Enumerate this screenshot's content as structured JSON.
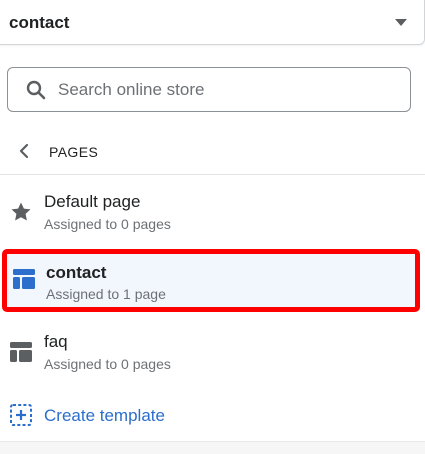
{
  "template_select": {
    "value": "contact"
  },
  "search": {
    "placeholder": "Search online store",
    "value": ""
  },
  "back": {
    "label": "PAGES"
  },
  "templates": [
    {
      "title": "Default page",
      "subtitle": "Assigned to 0 pages",
      "icon": "star-icon"
    },
    {
      "title": "contact",
      "subtitle": "Assigned to 1 page",
      "icon": "layout-icon",
      "selected": true
    },
    {
      "title": "faq",
      "subtitle": "Assigned to 0 pages",
      "icon": "layout-icon"
    }
  ],
  "create": {
    "label": "Create template",
    "icon": "add-template-icon"
  },
  "colors": {
    "link": "#2c6ecb",
    "selected_bg": "#f2f7fe",
    "highlight_border": "#ff0000",
    "icon": "#5c5f62"
  }
}
